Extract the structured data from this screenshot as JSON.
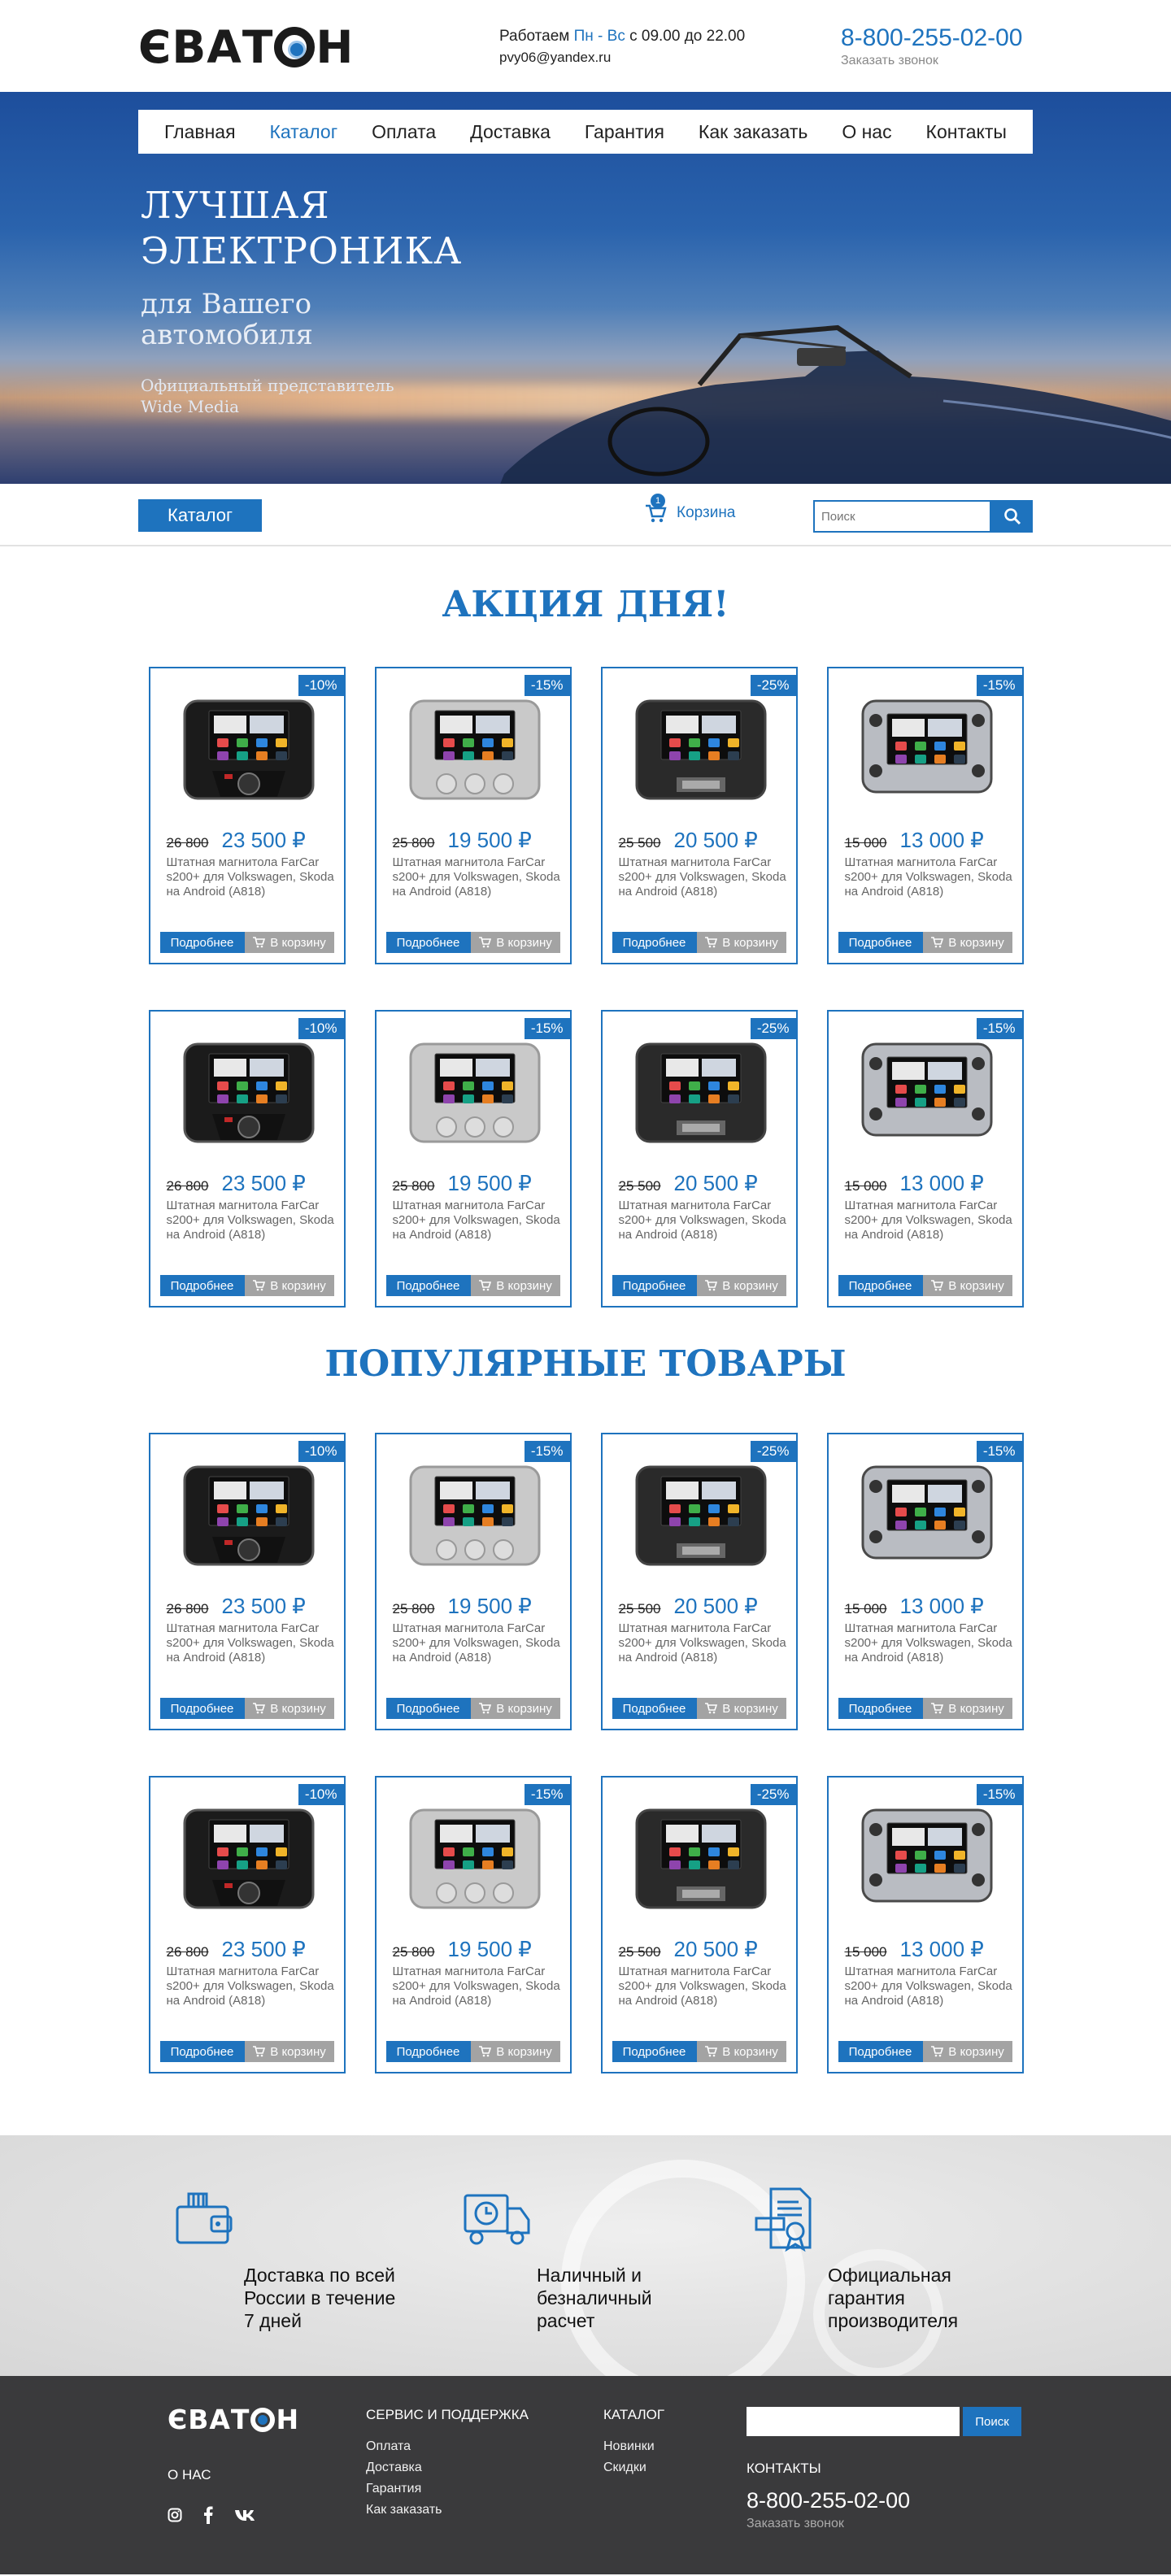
{
  "header": {
    "logo": "ЄВАТОН",
    "work_prefix": "Работаем",
    "work_days": "Пн - Вс",
    "work_hours": "с 09.00 до 22.00",
    "email": "pvy06@yandex.ru",
    "phone": "8-800-255-02-00",
    "callback": "Заказать звонок"
  },
  "menu": [
    {
      "label": "Главная",
      "active": false
    },
    {
      "label": "Каталог",
      "active": true
    },
    {
      "label": "Оплата",
      "active": false
    },
    {
      "label": "Доставка",
      "active": false
    },
    {
      "label": "Гарантия",
      "active": false
    },
    {
      "label": "Как заказать",
      "active": false
    },
    {
      "label": "О нас",
      "active": false
    },
    {
      "label": "Контакты",
      "active": false
    }
  ],
  "hero": {
    "title_line1": "ЛУЧШАЯ",
    "title_line2": "ЭЛЕКТРОНИКА",
    "subtitle_line1": "для Вашего",
    "subtitle_line2": "автомобиля",
    "note_line1": "Официальный представитель",
    "note_line2": "Wide Media"
  },
  "toolbar": {
    "catalog": "Каталог",
    "cart_label": "Корзина",
    "cart_count": "1",
    "search_placeholder": "Поиск"
  },
  "sections": {
    "sale_title": "АКЦИЯ  ДНЯ!",
    "popular_title": "ПОПУЛЯРНЫЕ ТОВАРЫ"
  },
  "card_buttons": {
    "more": "Подробнее",
    "cart": "В корзину"
  },
  "products": [
    {
      "discount": "-10%",
      "old": "26 800",
      "price": "23 500 ₽",
      "name": "Штатная магнитола FarCar s200+ для Volkswagen, Skoda на Android (A818)",
      "style": "ford"
    },
    {
      "discount": "-15%",
      "old": "25 800",
      "price": "19 500 ₽",
      "name": "Штатная магнитола FarCar s200+ для Volkswagen, Skoda на Android (A818)",
      "style": "silver"
    },
    {
      "discount": "-25%",
      "old": "25 500",
      "price": "20 500 ₽",
      "name": "Штатная магнитола FarCar s200+ для Volkswagen, Skoda на Android (A818)",
      "style": "dark"
    },
    {
      "discount": "-15%",
      "old": "15 000",
      "price": "13 000 ₽",
      "name": "Штатная магнитола FarCar s200+ для Volkswagen, Skoda на Android (A818)",
      "style": "hyundai"
    }
  ],
  "features": [
    {
      "icon": "wallet-icon",
      "line1": "Доставка по всей",
      "line2": "России в течение",
      "line3": "7 дней"
    },
    {
      "icon": "delivery-truck-icon",
      "line1": "Наличный и",
      "line2": "безналичный",
      "line3": "расчет"
    },
    {
      "icon": "certificate-icon",
      "line1": "Официальная",
      "line2": "гарантия",
      "line3": "производителя"
    }
  ],
  "footer": {
    "logo": "ЄВАТОН",
    "about": "О НАС",
    "service_title": "СЕРВИС И ПОДДЕРЖКА",
    "service_items": [
      "Оплата",
      "Доставка",
      "Гарантия",
      "Как заказать"
    ],
    "catalog_title": "КАТАЛОГ",
    "catalog_items": [
      "Новинки",
      "Скидки"
    ],
    "search_button": "Поиск",
    "contacts_title": "КОНТАКТЫ",
    "phone": "8-800-255-02-00",
    "callback": "Заказать звонок",
    "social_icons": [
      "instagram-icon",
      "facebook-icon",
      "vk-icon"
    ]
  },
  "colors": {
    "accent": "#1e73be",
    "dark": "#3a3a3c",
    "muted_button": "#a3a3a3"
  }
}
